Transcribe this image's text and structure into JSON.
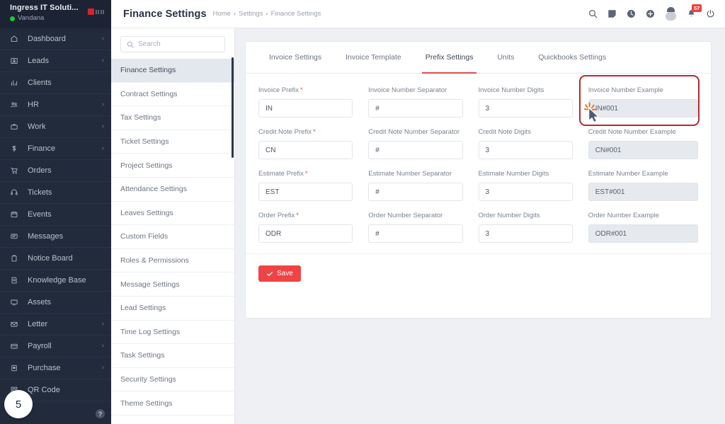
{
  "sidebar": {
    "org_name": "Ingress IT Soluti...",
    "user_name": "Vandana",
    "help_label": "?",
    "step_badge": "5",
    "items": [
      {
        "label": "Dashboard",
        "icon": "home-icon",
        "chevron": "›"
      },
      {
        "label": "Leads",
        "icon": "leads-icon",
        "chevron": "›"
      },
      {
        "label": "Clients",
        "icon": "clients-icon",
        "chevron": ""
      },
      {
        "label": "HR",
        "icon": "people-icon",
        "chevron": "›"
      },
      {
        "label": "Work",
        "icon": "briefcase-icon",
        "chevron": "›"
      },
      {
        "label": "Finance",
        "icon": "dollar-icon",
        "chevron": "›"
      },
      {
        "label": "Orders",
        "icon": "cart-icon",
        "chevron": ""
      },
      {
        "label": "Tickets",
        "icon": "headset-icon",
        "chevron": ""
      },
      {
        "label": "Events",
        "icon": "calendar-icon",
        "chevron": ""
      },
      {
        "label": "Messages",
        "icon": "message-icon",
        "chevron": ""
      },
      {
        "label": "Notice Board",
        "icon": "clipboard-icon",
        "chevron": ""
      },
      {
        "label": "Knowledge Base",
        "icon": "book-icon",
        "chevron": ""
      },
      {
        "label": "Assets",
        "icon": "monitor-icon",
        "chevron": ""
      },
      {
        "label": "Letter",
        "icon": "envelope-icon",
        "chevron": "›"
      },
      {
        "label": "Payroll",
        "icon": "wallet-icon",
        "chevron": "›"
      },
      {
        "label": "Purchase",
        "icon": "purchase-icon",
        "chevron": "›"
      },
      {
        "label": "QR Code",
        "icon": "qrcode-icon",
        "chevron": ""
      }
    ]
  },
  "topbar": {
    "title": "Finance Settings",
    "breadcrumb": [
      "Home",
      "Settings",
      "Finance Settings"
    ],
    "separator": "•",
    "icons": [
      "search-icon",
      "note-icon",
      "clock-icon",
      "plus-circle-icon"
    ],
    "notification_count": "57"
  },
  "settings_nav": {
    "search_placeholder": "Search",
    "search_value": "",
    "items": [
      {
        "label": "Finance Settings",
        "active": true
      },
      {
        "label": "Contract Settings",
        "active": false
      },
      {
        "label": "Tax Settings",
        "active": false
      },
      {
        "label": "Ticket Settings",
        "active": false
      },
      {
        "label": "Project Settings",
        "active": false
      },
      {
        "label": "Attendance Settings",
        "active": false
      },
      {
        "label": "Leaves Settings",
        "active": false
      },
      {
        "label": "Custom Fields",
        "active": false
      },
      {
        "label": "Roles & Permissions",
        "active": false
      },
      {
        "label": "Message Settings",
        "active": false
      },
      {
        "label": "Lead Settings",
        "active": false
      },
      {
        "label": "Time Log Settings",
        "active": false
      },
      {
        "label": "Task Settings",
        "active": false
      },
      {
        "label": "Security Settings",
        "active": false
      },
      {
        "label": "Theme Settings",
        "active": false
      }
    ]
  },
  "tabs": [
    {
      "label": "Invoice Settings",
      "active": false
    },
    {
      "label": "Invoice Template",
      "active": false
    },
    {
      "label": "Prefix Settings",
      "active": true
    },
    {
      "label": "Units",
      "active": false
    },
    {
      "label": "Quickbooks Settings",
      "active": false
    }
  ],
  "form": {
    "rows": [
      {
        "prefix": {
          "label": "Invoice Prefix",
          "required": true,
          "value": "IN"
        },
        "separator": {
          "label": "Invoice Number Separator",
          "required": false,
          "value": "#"
        },
        "digits": {
          "label": "Invoice Number Digits",
          "required": false,
          "value": "3"
        },
        "example": {
          "label": "Invoice Number Example",
          "required": false,
          "value": "IN#001",
          "highlighted": true
        }
      },
      {
        "prefix": {
          "label": "Credit Note Prefix",
          "required": true,
          "value": "CN"
        },
        "separator": {
          "label": "Credit Note Number Separator",
          "required": false,
          "value": "#"
        },
        "digits": {
          "label": "Credit Note Digits",
          "required": false,
          "value": "3"
        },
        "example": {
          "label": "Credit Note Number Example",
          "required": false,
          "value": "CN#001",
          "highlighted": false
        }
      },
      {
        "prefix": {
          "label": "Estimate Prefix",
          "required": true,
          "value": "EST"
        },
        "separator": {
          "label": "Estimate Number Separator",
          "required": false,
          "value": "#"
        },
        "digits": {
          "label": "Estimate Number Digits",
          "required": false,
          "value": "3"
        },
        "example": {
          "label": "Estimate Number Example",
          "required": false,
          "value": "EST#001",
          "highlighted": false
        }
      },
      {
        "prefix": {
          "label": "Order Prefix",
          "required": true,
          "value": "ODR"
        },
        "separator": {
          "label": "Order Number Separator",
          "required": false,
          "value": "#"
        },
        "digits": {
          "label": "Order Number Digits",
          "required": false,
          "value": "3"
        },
        "example": {
          "label": "Order Number Example",
          "required": false,
          "value": "ODR#001",
          "highlighted": false
        }
      }
    ],
    "save_label": "Save",
    "required_marker": "*"
  },
  "colors": {
    "sidebar_bg": "#222b3c",
    "accent_red": "#ef4444",
    "tab_underline": "#e24c4c",
    "highlight_border": "#b62a30",
    "cursor_accent": "#f4761b",
    "online_dot": "#25c335",
    "badge_bg": "#ef4040"
  }
}
